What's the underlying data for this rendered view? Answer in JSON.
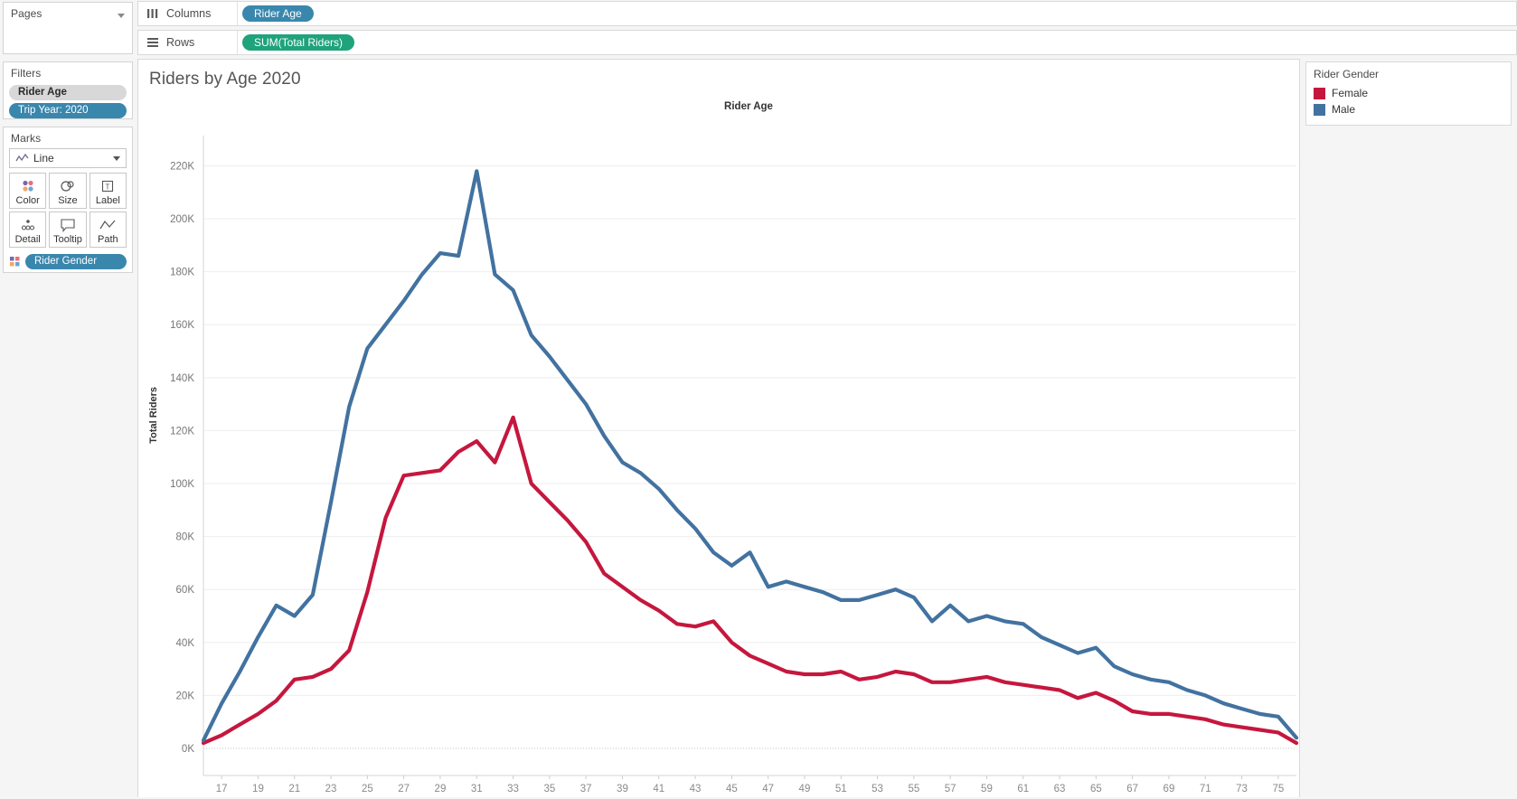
{
  "left_panel": {
    "pages": {
      "title": "Pages",
      "caret_icon": "chevron-down-icon"
    },
    "filters": {
      "title": "Filters",
      "items": [
        {
          "label": "Rider Age",
          "style": "grey"
        },
        {
          "label": "Trip Year: 2020",
          "style": "blue"
        }
      ]
    },
    "marks": {
      "title": "Marks",
      "mark_type": "Line",
      "mark_type_icon": "line-mark-icon",
      "buttons": [
        {
          "label": "Color",
          "icon": "color-icon"
        },
        {
          "label": "Size",
          "icon": "size-icon"
        },
        {
          "label": "Label",
          "icon": "label-icon"
        },
        {
          "label": "Detail",
          "icon": "detail-icon"
        },
        {
          "label": "Tooltip",
          "icon": "tooltip-icon"
        },
        {
          "label": "Path",
          "icon": "path-icon"
        }
      ],
      "encoding_pill": {
        "label": "Rider Gender",
        "icon": "color-icon"
      }
    }
  },
  "shelves": {
    "columns": {
      "label": "Columns",
      "icon": "columns-icon",
      "pills": [
        {
          "label": "Rider Age",
          "type": "dimension"
        }
      ]
    },
    "rows": {
      "label": "Rows",
      "icon": "rows-icon",
      "pills": [
        {
          "label": "SUM(Total Riders)",
          "type": "measure"
        }
      ]
    }
  },
  "view": {
    "title": "Riders by Age 2020",
    "column_header": "Rider Age"
  },
  "legend": {
    "title": "Rider Gender",
    "items": [
      {
        "label": "Female",
        "color": "#C5173E"
      },
      {
        "label": "Male",
        "color": "#4272A0"
      }
    ]
  },
  "colors": {
    "female": "#C5173E",
    "male": "#4272A0",
    "dimension_pill": "#3A87AD",
    "measure_pill": "#1FA37A",
    "grid": "#EEEEEE"
  },
  "chart_data": {
    "type": "line",
    "title": "Riders by Age 2020",
    "xlabel": "Rider Age",
    "ylabel": "Total Riders",
    "xlim": [
      16,
      76
    ],
    "ylim": [
      0,
      228000
    ],
    "ytick_values": [
      0,
      20000,
      40000,
      60000,
      80000,
      100000,
      120000,
      140000,
      160000,
      180000,
      200000,
      220000
    ],
    "ytick_labels": [
      "0K",
      "20K",
      "40K",
      "60K",
      "80K",
      "100K",
      "120K",
      "140K",
      "160K",
      "180K",
      "200K",
      "220K"
    ],
    "xtick_values": [
      17,
      19,
      21,
      23,
      25,
      27,
      29,
      31,
      33,
      35,
      37,
      39,
      41,
      43,
      45,
      47,
      49,
      51,
      53,
      55,
      57,
      59,
      61,
      63,
      65,
      67,
      69,
      71,
      73,
      75
    ],
    "xtick_labels": [
      "17",
      "19",
      "21",
      "23",
      "25",
      "27",
      "29",
      "31",
      "33",
      "35",
      "37",
      "39",
      "41",
      "43",
      "45",
      "47",
      "49",
      "51",
      "53",
      "55",
      "57",
      "59",
      "61",
      "63",
      "65",
      "67",
      "69",
      "71",
      "73",
      "75"
    ],
    "grid": true,
    "legend_position": "right",
    "x": [
      16,
      17,
      18,
      19,
      20,
      21,
      22,
      23,
      24,
      25,
      26,
      27,
      28,
      29,
      30,
      31,
      32,
      33,
      34,
      35,
      36,
      37,
      38,
      39,
      40,
      41,
      42,
      43,
      44,
      45,
      46,
      47,
      48,
      49,
      50,
      51,
      52,
      53,
      54,
      55,
      56,
      57,
      58,
      59,
      60,
      61,
      62,
      63,
      64,
      65,
      66,
      67,
      68,
      69,
      70,
      71,
      72,
      73,
      74,
      75,
      76
    ],
    "series": [
      {
        "name": "Male",
        "color": "#4272A0",
        "values": [
          3000,
          17000,
          29000,
          42000,
          54000,
          50000,
          58000,
          93000,
          129000,
          151000,
          160000,
          169000,
          179000,
          187000,
          186000,
          218000,
          179000,
          173000,
          156000,
          148000,
          139000,
          130000,
          118000,
          108000,
          104000,
          98000,
          90000,
          83000,
          74000,
          69000,
          74000,
          61000,
          63000,
          61000,
          59000,
          56000,
          56000,
          58000,
          60000,
          57000,
          48000,
          54000,
          48000,
          50000,
          48000,
          47000,
          42000,
          39000,
          36000,
          38000,
          31000,
          28000,
          26000,
          25000,
          22000,
          20000,
          17000,
          15000,
          13000,
          12000,
          4000
        ]
      },
      {
        "name": "Female",
        "color": "#C5173E",
        "values": [
          2000,
          5000,
          9000,
          13000,
          18000,
          26000,
          27000,
          30000,
          37000,
          59000,
          87000,
          103000,
          104000,
          105000,
          112000,
          116000,
          108000,
          125000,
          100000,
          93000,
          86000,
          78000,
          66000,
          61000,
          56000,
          52000,
          47000,
          46000,
          48000,
          40000,
          35000,
          32000,
          29000,
          28000,
          28000,
          29000,
          26000,
          27000,
          29000,
          28000,
          25000,
          25000,
          26000,
          27000,
          25000,
          24000,
          23000,
          22000,
          19000,
          21000,
          18000,
          14000,
          13000,
          13000,
          12000,
          11000,
          9000,
          8000,
          7000,
          6000,
          2000
        ]
      }
    ]
  }
}
